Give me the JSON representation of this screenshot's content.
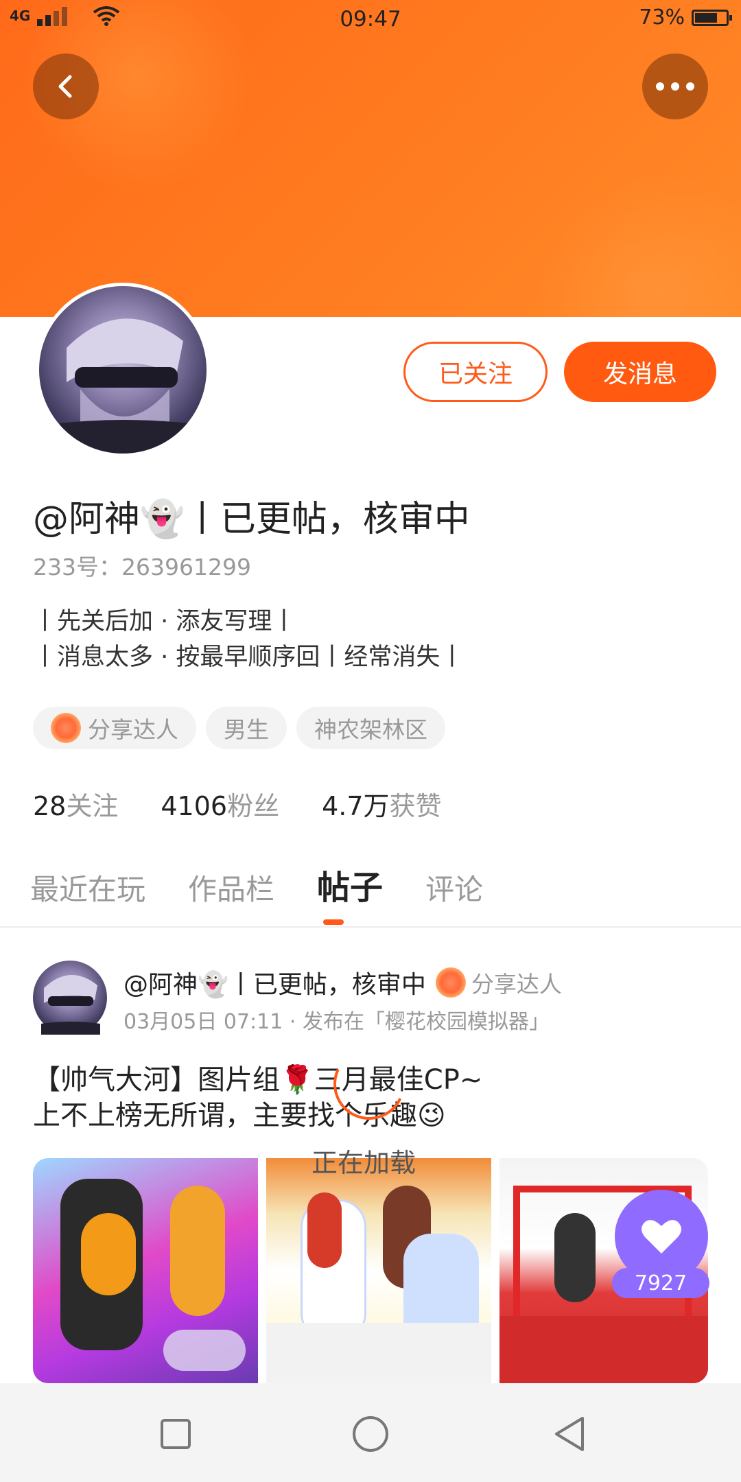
{
  "status_bar": {
    "network": "4G",
    "time": "09:47",
    "battery_percent": "73%",
    "battery_level": 0.73
  },
  "header": {
    "back_icon": "chevron-left-icon",
    "more_icon": "more-dots-icon"
  },
  "profile": {
    "follow_button": "已关注",
    "message_button": "发消息",
    "name": "@阿神👻丨已更帖，核审中",
    "uid": "233号：263961299",
    "bio_line1": "丨先关后加 · 添友写理丨",
    "bio_line2": "丨消息太多 · 按最早顺序回丨经常消失丨",
    "tags": [
      "分享达人",
      "男生",
      "神农架林区"
    ],
    "stats": {
      "following_num": "28",
      "following_label": "关注",
      "fans_num": "4106",
      "fans_label": "粉丝",
      "likes_num": "4.7万",
      "likes_label": "获赞"
    }
  },
  "tabs": [
    "最近在玩",
    "作品栏",
    "帖子",
    "评论"
  ],
  "active_tab": "帖子",
  "post": {
    "author": "@阿神👻丨已更帖，核审中",
    "badge": "分享达人",
    "meta": "03月05日 07:11 · 发布在「樱花校园模拟器」",
    "text_line1": "【帅气大河】图片组🌹三月最佳CP~",
    "text_line2": "上不上榜无所谓，主要找个乐趣😉",
    "loading": "正在加载",
    "like_count": "7927"
  },
  "colors": {
    "accent": "#ff5a1a",
    "like": "#8f6cff"
  }
}
